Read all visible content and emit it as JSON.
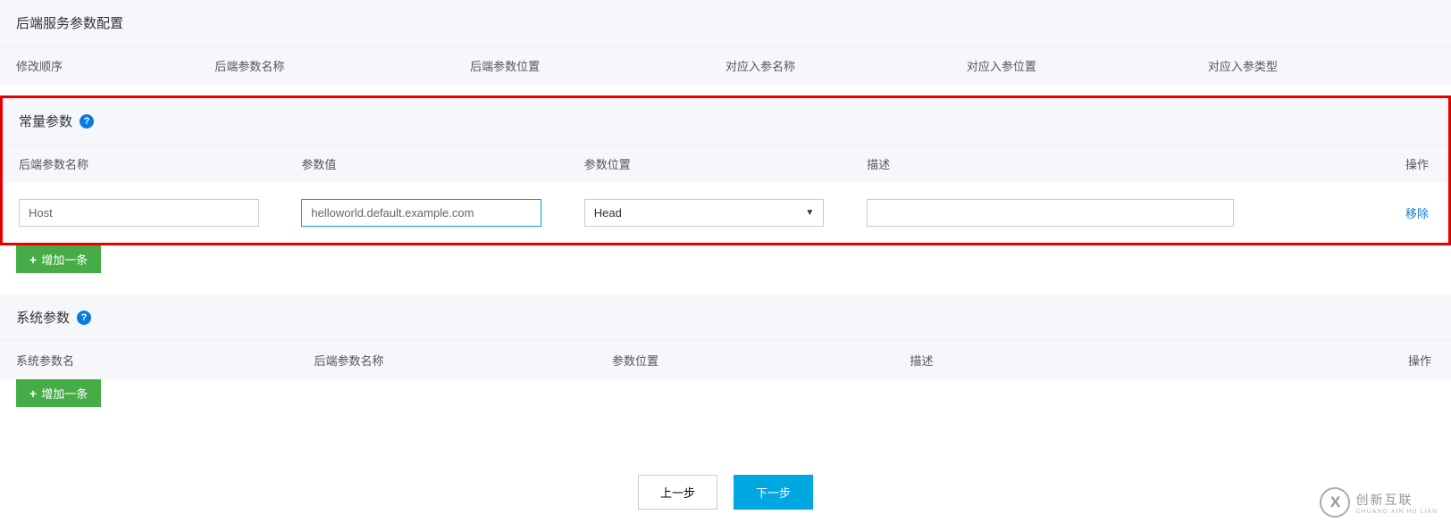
{
  "backendPanel": {
    "title": "后端服务参数配置",
    "headers": {
      "order": "修改顺序",
      "paramName": "后端参数名称",
      "paramPos": "后端参数位置",
      "inName": "对应入参名称",
      "inPos": "对应入参位置",
      "inType": "对应入参类型"
    }
  },
  "constPanel": {
    "title": "常量参数",
    "headers": {
      "paramName": "后端参数名称",
      "paramValue": "参数值",
      "paramPos": "参数位置",
      "desc": "描述",
      "action": "操作"
    },
    "row": {
      "name": "Host",
      "value": "helloworld.default.example.com",
      "pos": "Head",
      "desc": "",
      "removeLabel": "移除"
    },
    "addLabel": "增加一条"
  },
  "sysPanel": {
    "title": "系统参数",
    "headers": {
      "sysName": "系统参数名",
      "paramName": "后端参数名称",
      "paramPos": "参数位置",
      "desc": "描述",
      "action": "操作"
    },
    "addLabel": "增加一条"
  },
  "footer": {
    "prev": "上一步",
    "next": "下一步"
  },
  "watermark": {
    "icon": "X",
    "text": "创新互联",
    "sub": "CHUANG XIN HU LIAN"
  }
}
